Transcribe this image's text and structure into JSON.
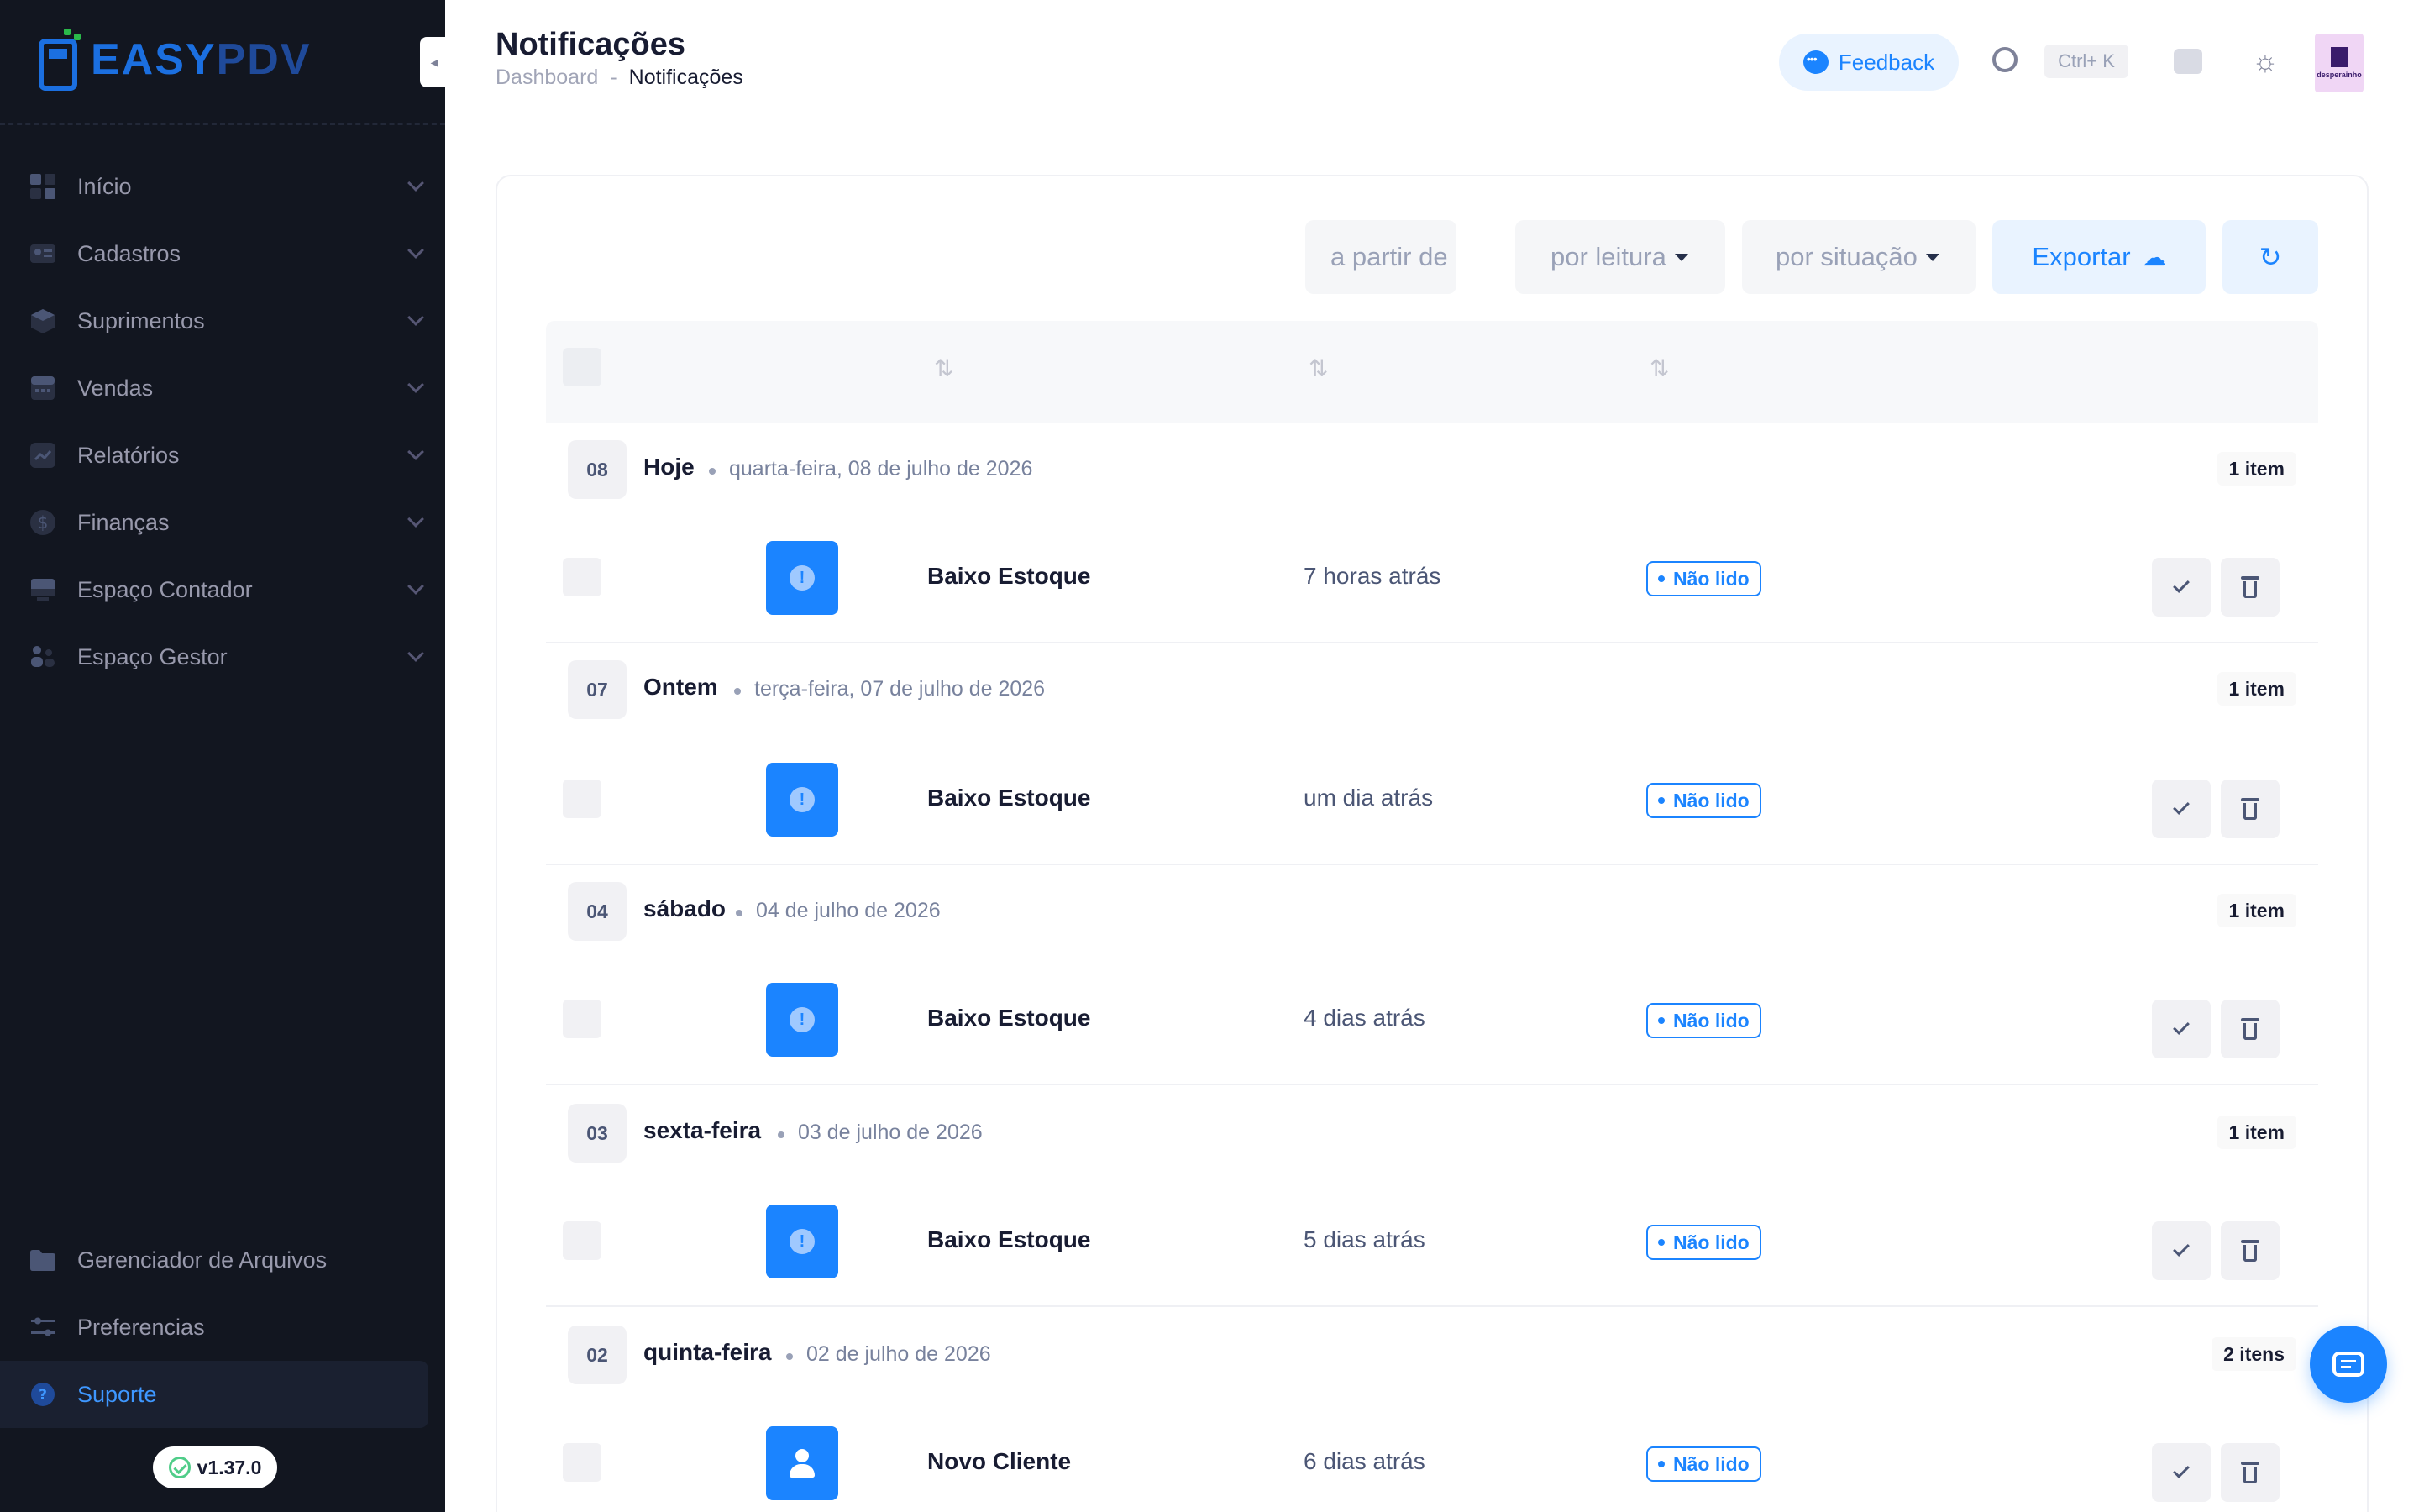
{
  "brand": {
    "part1": "EASY",
    "part2": "PDV"
  },
  "sidebar": {
    "items": [
      {
        "label": "Início",
        "icon": "grid-icon"
      },
      {
        "label": "Cadastros",
        "icon": "id-card-icon"
      },
      {
        "label": "Suprimentos",
        "icon": "box-icon"
      },
      {
        "label": "Vendas",
        "icon": "calculator-icon"
      },
      {
        "label": "Relatórios",
        "icon": "chart-icon"
      },
      {
        "label": "Finanças",
        "icon": "dollar-icon"
      },
      {
        "label": "Espaço Contador",
        "icon": "monitor-icon"
      },
      {
        "label": "Espaço Gestor",
        "icon": "users-icon"
      }
    ],
    "bottom": [
      {
        "label": "Gerenciador de Arquivos",
        "icon": "folder-icon"
      },
      {
        "label": "Preferencias",
        "icon": "sliders-icon"
      },
      {
        "label": "Suporte",
        "icon": "help-icon"
      }
    ],
    "version": "v1.37.0"
  },
  "header": {
    "title": "Notificações",
    "breadcrumb": [
      "Dashboard",
      "-",
      "Notificações"
    ],
    "feedback_label": "Feedback",
    "shortcut": "Ctrl+ K",
    "avatar_text": "desperainho"
  },
  "filters": {
    "date_placeholder": "a partir de",
    "reading": "por leitura",
    "status": "por situação",
    "export_label": "Exportar"
  },
  "groups": [
    {
      "day": "08",
      "name": "Hoje",
      "date": "quarta-feira, 08 de julho de 2026",
      "count": "1 item",
      "items": [
        {
          "title": "Baixo Estoque",
          "time": "7 horas atrás",
          "status": "Não lido",
          "kind": "alert"
        }
      ]
    },
    {
      "day": "07",
      "name": "Ontem",
      "date": "terça-feira, 07 de julho de 2026",
      "count": "1 item",
      "items": [
        {
          "title": "Baixo Estoque",
          "time": "um dia atrás",
          "status": "Não lido",
          "kind": "alert"
        }
      ]
    },
    {
      "day": "04",
      "name": "sábado",
      "date": "04 de julho de 2026",
      "count": "1 item",
      "items": [
        {
          "title": "Baixo Estoque",
          "time": "4 dias atrás",
          "status": "Não lido",
          "kind": "alert"
        }
      ]
    },
    {
      "day": "03",
      "name": "sexta-feira",
      "date": "03 de julho de 2026",
      "count": "1 item",
      "items": [
        {
          "title": "Baixo Estoque",
          "time": "5 dias atrás",
          "status": "Não lido",
          "kind": "alert"
        }
      ]
    },
    {
      "day": "02",
      "name": "quinta-feira",
      "date": "02 de julho de 2026",
      "count": "2 itens",
      "items": [
        {
          "title": "Novo Cliente",
          "time": "6 dias atrás",
          "status": "Não lido",
          "kind": "user"
        }
      ]
    }
  ],
  "colors": {
    "primary": "#1b84ff",
    "sidebar": "#121620",
    "active": "#3e97ff"
  }
}
